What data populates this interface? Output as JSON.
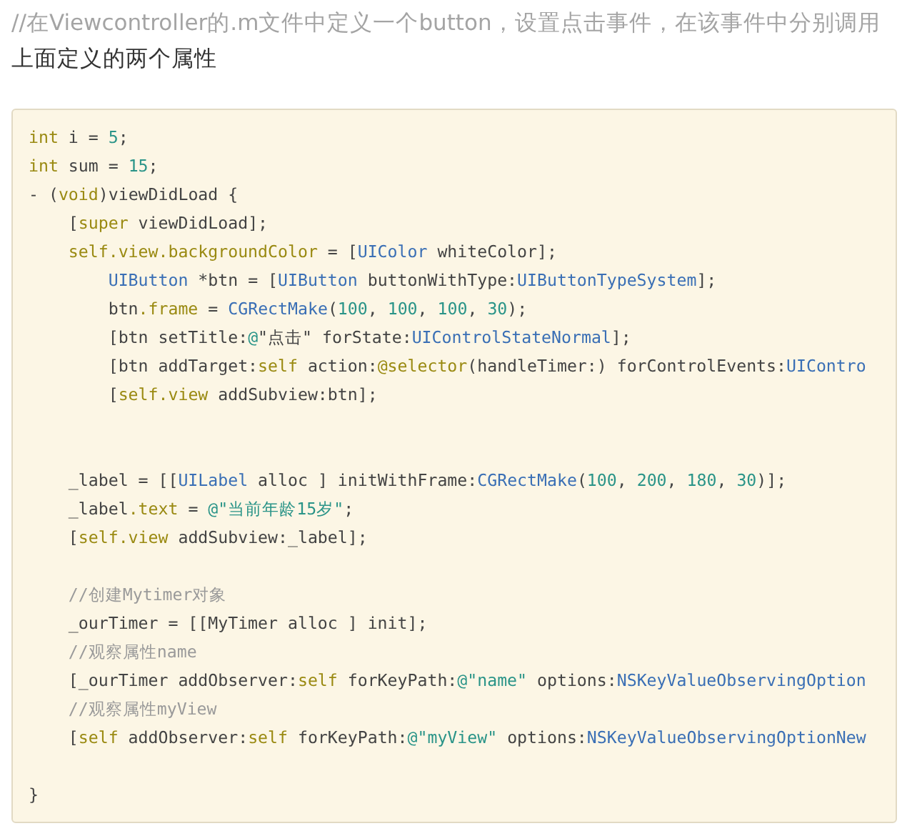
{
  "heading": [
    {
      "text": "//在Viewcontroller的.m文件中定义一个button，设置点击事件，在该事件中分别调用",
      "faded": true
    },
    {
      "text": "上面定义的两个属性",
      "faded": false
    }
  ],
  "code_block": {
    "lines": [
      {
        "kind": "code",
        "tokens": [
          {
            "t": "int",
            "color": "#9a8a12"
          },
          {
            "t": " i = ",
            "color": "#444444"
          },
          {
            "t": "5",
            "color": "#2a9488"
          },
          {
            "t": ";",
            "color": "#444444"
          }
        ]
      },
      {
        "kind": "code",
        "tokens": [
          {
            "t": "int",
            "color": "#9a8a12"
          },
          {
            "t": " sum = ",
            "color": "#444444"
          },
          {
            "t": "15",
            "color": "#2a9488"
          },
          {
            "t": ";",
            "color": "#444444"
          }
        ]
      },
      {
        "kind": "code",
        "tokens": [
          {
            "t": "- (",
            "color": "#444444"
          },
          {
            "t": "void",
            "color": "#9a8a12"
          },
          {
            "t": ")viewDidLoad {",
            "color": "#444444"
          }
        ]
      },
      {
        "kind": "code",
        "tokens": [
          {
            "t": "    [",
            "color": "#444444"
          },
          {
            "t": "super",
            "color": "#9a8a12"
          },
          {
            "t": " viewDidLoad];",
            "color": "#444444"
          }
        ]
      },
      {
        "kind": "code",
        "tokens": [
          {
            "t": "    self.view.backgroundColor",
            "color": "#9a8a12"
          },
          {
            "t": " = [",
            "color": "#444444"
          },
          {
            "t": "UIColor",
            "color": "#3a6fb5"
          },
          {
            "t": " whiteColor];",
            "color": "#444444"
          }
        ]
      },
      {
        "kind": "code",
        "tokens": [
          {
            "t": "        UIButton",
            "color": "#3a6fb5"
          },
          {
            "t": " *btn = [",
            "color": "#444444"
          },
          {
            "t": "UIButton",
            "color": "#3a6fb5"
          },
          {
            "t": " buttonWithType:",
            "color": "#444444"
          },
          {
            "t": "UIButtonTypeSystem",
            "color": "#3a6fb5"
          },
          {
            "t": "];",
            "color": "#444444"
          }
        ]
      },
      {
        "kind": "code",
        "tokens": [
          {
            "t": "        btn",
            "color": "#444444"
          },
          {
            "t": ".frame",
            "color": "#9a8a12"
          },
          {
            "t": " = ",
            "color": "#444444"
          },
          {
            "t": "CGRectMake",
            "color": "#3a6fb5"
          },
          {
            "t": "(",
            "color": "#444444"
          },
          {
            "t": "100",
            "color": "#2a9488"
          },
          {
            "t": ", ",
            "color": "#444444"
          },
          {
            "t": "100",
            "color": "#2a9488"
          },
          {
            "t": ", ",
            "color": "#444444"
          },
          {
            "t": "100",
            "color": "#2a9488"
          },
          {
            "t": ", ",
            "color": "#444444"
          },
          {
            "t": "30",
            "color": "#2a9488"
          },
          {
            "t": ");",
            "color": "#444444"
          }
        ]
      },
      {
        "kind": "code",
        "tokens": [
          {
            "t": "        [btn setTitle:",
            "color": "#444444"
          },
          {
            "t": "@",
            "color": "#2a9488"
          },
          {
            "t": "\"点击\" forState:",
            "color": "#444444"
          },
          {
            "t": "UIControlStateNormal",
            "color": "#3a6fb5"
          },
          {
            "t": "];",
            "color": "#444444"
          }
        ]
      },
      {
        "kind": "code",
        "tokens": [
          {
            "t": "        [btn addTarget:",
            "color": "#444444"
          },
          {
            "t": "self",
            "color": "#9a8a12"
          },
          {
            "t": " action:",
            "color": "#444444"
          },
          {
            "t": "@selector",
            "color": "#9a8a12"
          },
          {
            "t": "(handleTimer:) forControlEvents:",
            "color": "#444444"
          },
          {
            "t": "UIContro",
            "color": "#3a6fb5"
          }
        ]
      },
      {
        "kind": "code",
        "tokens": [
          {
            "t": "        [",
            "color": "#444444"
          },
          {
            "t": "self.view",
            "color": "#9a8a12"
          },
          {
            "t": " addSubview:btn];",
            "color": "#444444"
          }
        ]
      },
      {
        "kind": "blank"
      },
      {
        "kind": "blank"
      },
      {
        "kind": "code",
        "tokens": [
          {
            "t": "    _label = [[",
            "color": "#444444"
          },
          {
            "t": "UILabel",
            "color": "#3a6fb5"
          },
          {
            "t": " alloc ] initWithFrame:",
            "color": "#444444"
          },
          {
            "t": "CGRectMake",
            "color": "#3a6fb5"
          },
          {
            "t": "(",
            "color": "#444444"
          },
          {
            "t": "100",
            "color": "#2a9488"
          },
          {
            "t": ", ",
            "color": "#444444"
          },
          {
            "t": "200",
            "color": "#2a9488"
          },
          {
            "t": ", ",
            "color": "#444444"
          },
          {
            "t": "180",
            "color": "#2a9488"
          },
          {
            "t": ", ",
            "color": "#444444"
          },
          {
            "t": "30",
            "color": "#2a9488"
          },
          {
            "t": ")];",
            "color": "#444444"
          }
        ]
      },
      {
        "kind": "code",
        "tokens": [
          {
            "t": "    _label",
            "color": "#444444"
          },
          {
            "t": ".text",
            "color": "#9a8a12"
          },
          {
            "t": " = ",
            "color": "#444444"
          },
          {
            "t": "@\"当前年龄15岁\"",
            "color": "#2a9488"
          },
          {
            "t": ";",
            "color": "#444444"
          }
        ]
      },
      {
        "kind": "code",
        "tokens": [
          {
            "t": "    [",
            "color": "#444444"
          },
          {
            "t": "self.view",
            "color": "#9a8a12"
          },
          {
            "t": " addSubview:_label];",
            "color": "#444444"
          }
        ]
      },
      {
        "kind": "blank"
      },
      {
        "kind": "code",
        "tokens": [
          {
            "t": "    //创建Mytimer对象",
            "color": "#9a9a9a"
          }
        ]
      },
      {
        "kind": "code",
        "tokens": [
          {
            "t": "    _ourTimer = [[MyTimer alloc ] init];",
            "color": "#444444"
          }
        ]
      },
      {
        "kind": "code",
        "tokens": [
          {
            "t": "    //观察属性name",
            "color": "#9a9a9a"
          }
        ]
      },
      {
        "kind": "code",
        "tokens": [
          {
            "t": "    [_ourTimer addObserver:",
            "color": "#444444"
          },
          {
            "t": "self",
            "color": "#9a8a12"
          },
          {
            "t": " forKeyPath:",
            "color": "#444444"
          },
          {
            "t": "@\"name\"",
            "color": "#2a9488"
          },
          {
            "t": " options:",
            "color": "#444444"
          },
          {
            "t": "NSKeyValueObservingOption",
            "color": "#3a6fb5"
          }
        ]
      },
      {
        "kind": "code",
        "tokens": [
          {
            "t": "    //观察属性myView",
            "color": "#9a9a9a"
          }
        ]
      },
      {
        "kind": "code",
        "tokens": [
          {
            "t": "    [",
            "color": "#444444"
          },
          {
            "t": "self",
            "color": "#9a8a12"
          },
          {
            "t": " addObserver:",
            "color": "#444444"
          },
          {
            "t": "self",
            "color": "#9a8a12"
          },
          {
            "t": " forKeyPath:",
            "color": "#444444"
          },
          {
            "t": "@\"myView\"",
            "color": "#2a9488"
          },
          {
            "t": " options:",
            "color": "#444444"
          },
          {
            "t": "NSKeyValueObservingOptionNew",
            "color": "#3a6fb5"
          }
        ]
      },
      {
        "kind": "blank"
      },
      {
        "kind": "code",
        "tokens": [
          {
            "t": "}",
            "color": "#444444"
          }
        ]
      }
    ]
  }
}
